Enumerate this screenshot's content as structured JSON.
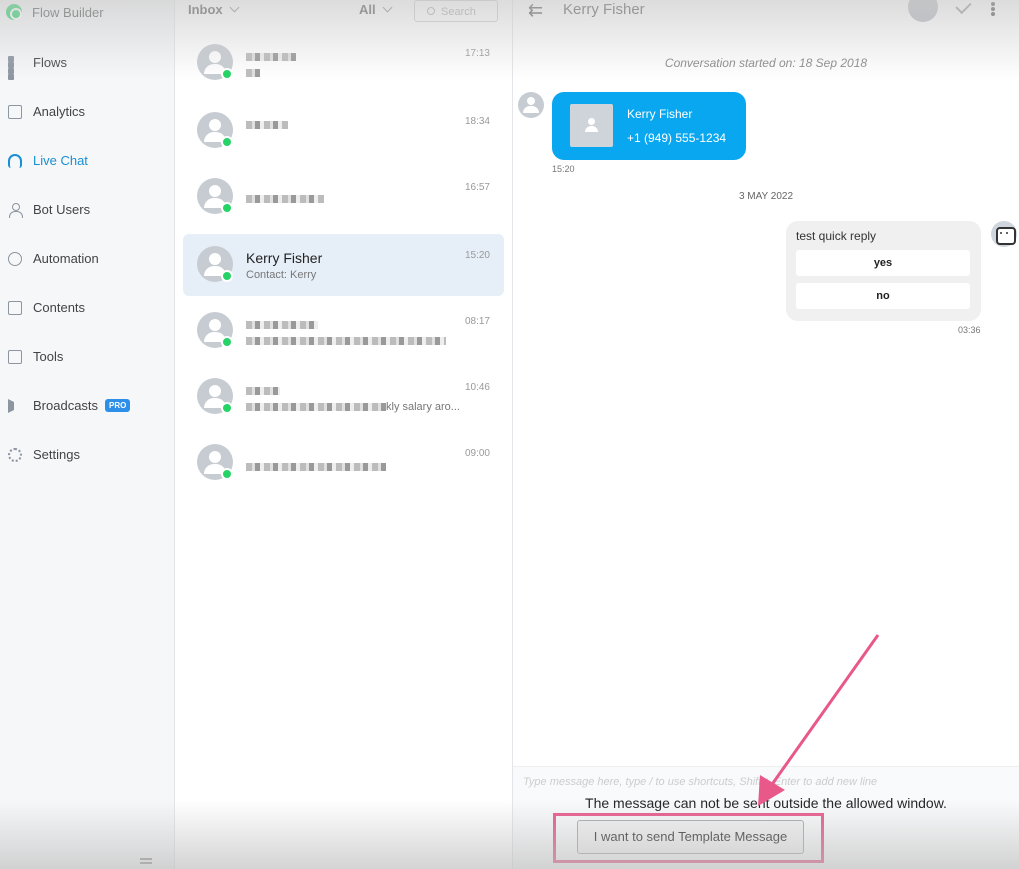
{
  "nav": {
    "brand": "Flow Builder",
    "items": [
      {
        "label": "Flows",
        "icon": "grid-icon"
      },
      {
        "label": "Analytics",
        "icon": "presentation-icon"
      },
      {
        "label": "Live Chat",
        "icon": "headset-icon",
        "active": true
      },
      {
        "label": "Bot Users",
        "icon": "user-icon"
      },
      {
        "label": "Automation",
        "icon": "automation-icon"
      },
      {
        "label": "Contents",
        "icon": "contents-icon"
      },
      {
        "label": "Tools",
        "icon": "toolbox-icon"
      },
      {
        "label": "Broadcasts",
        "icon": "megaphone-icon",
        "badge": "PRO"
      },
      {
        "label": "Settings",
        "icon": "gear-icon"
      }
    ]
  },
  "list": {
    "inbox_label": "Inbox",
    "filter_label": "All",
    "search_placeholder": "Search",
    "conversations": [
      {
        "time": "17:13"
      },
      {
        "time": "18:34"
      },
      {
        "time": "16:57"
      },
      {
        "name": "Kerry Fisher",
        "subtitle": "Contact: Kerry",
        "time": "15:20",
        "active": true
      },
      {
        "time": "08:17"
      },
      {
        "time": "10:46",
        "snippet": "kly salary aro..."
      },
      {
        "time": "09:00"
      }
    ]
  },
  "chat": {
    "title": "Kerry Fisher",
    "started": "Conversation started on: 18 Sep 2018",
    "contact_card": {
      "name": "Kerry Fisher",
      "phone": "+1 (949) 555-1234"
    },
    "contact_time": "15:20",
    "date_separator": "3 MAY 2022",
    "quick_reply": {
      "text": "test quick reply",
      "buttons": [
        "yes",
        "no"
      ],
      "time": "03:36"
    },
    "composer_placeholder": "Type message here, type / to use shortcuts, Shift + Enter to add new line",
    "window_notice": "The message can not be sent outside the allowed window.",
    "template_button": "I want to send Template Message"
  },
  "colors": {
    "accent": "#1a8fd4",
    "bubble": "#0aa7f1",
    "highlight": "#e8598a",
    "whatsapp": "#25d366"
  }
}
